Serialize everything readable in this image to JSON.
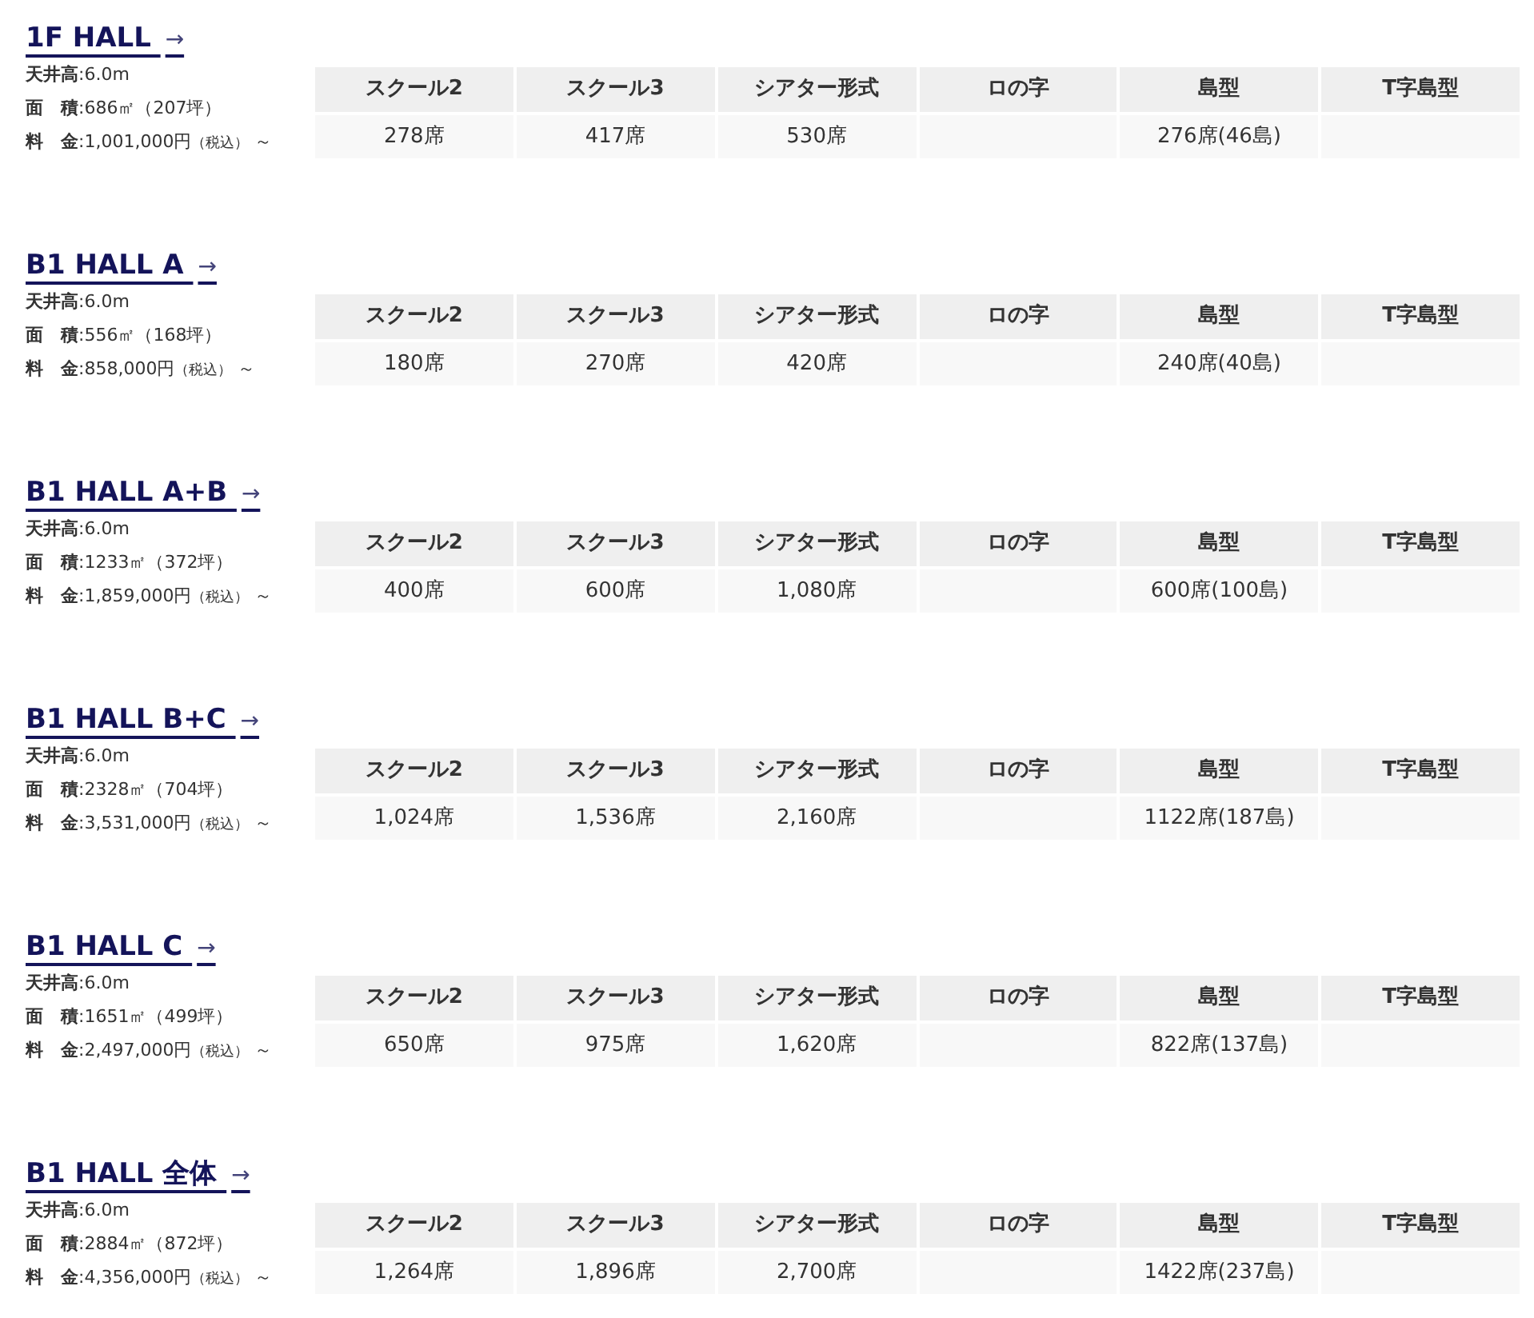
{
  "halls": [
    {
      "title": "1F HALL",
      "arrow": "→",
      "info": [
        {
          "label": "天井高",
          "value": ":6.0m"
        },
        {
          "label": "面　積",
          "value": ":686㎡（207坪）"
        },
        {
          "label": "料　金",
          "value": ":1,001,000円",
          "note": "（税込）",
          "suffix": "～"
        }
      ],
      "columns": [
        "スクール2",
        "スクール3",
        "シアター形式",
        "ロの字",
        "島型",
        "T字島型"
      ],
      "cells": [
        "278席",
        "417席",
        "530席",
        "",
        "276席(46島)",
        ""
      ]
    },
    {
      "title": "B1 HALL A",
      "arrow": "→",
      "info": [
        {
          "label": "天井高",
          "value": ":6.0m"
        },
        {
          "label": "面　積",
          "value": ":556㎡（168坪）"
        },
        {
          "label": "料　金",
          "value": ":858,000円",
          "note": "（税込）",
          "suffix": "～"
        }
      ],
      "columns": [
        "スクール2",
        "スクール3",
        "シアター形式",
        "ロの字",
        "島型",
        "T字島型"
      ],
      "cells": [
        "180席",
        "270席",
        "420席",
        "",
        "240席(40島)",
        ""
      ]
    },
    {
      "title": "B1 HALL A+B",
      "arrow": "→",
      "info": [
        {
          "label": "天井高",
          "value": ":6.0m"
        },
        {
          "label": "面　積",
          "value": ":1233㎡（372坪）"
        },
        {
          "label": "料　金",
          "value": ":1,859,000円",
          "note": "（税込）",
          "suffix": "～"
        }
      ],
      "columns": [
        "スクール2",
        "スクール3",
        "シアター形式",
        "ロの字",
        "島型",
        "T字島型"
      ],
      "cells": [
        "400席",
        "600席",
        "1,080席",
        "",
        "600席(100島)",
        ""
      ]
    },
    {
      "title": "B1 HALL B+C",
      "arrow": "→",
      "info": [
        {
          "label": "天井高",
          "value": ":6.0m"
        },
        {
          "label": "面　積",
          "value": ":2328㎡（704坪）"
        },
        {
          "label": "料　金",
          "value": ":3,531,000円",
          "note": "（税込）",
          "suffix": "～"
        }
      ],
      "columns": [
        "スクール2",
        "スクール3",
        "シアター形式",
        "ロの字",
        "島型",
        "T字島型"
      ],
      "cells": [
        "1,024席",
        "1,536席",
        "2,160席",
        "",
        "1122席(187島)",
        ""
      ]
    },
    {
      "title": "B1 HALL C",
      "arrow": "→",
      "info": [
        {
          "label": "天井高",
          "value": ":6.0m"
        },
        {
          "label": "面　積",
          "value": ":1651㎡（499坪）"
        },
        {
          "label": "料　金",
          "value": ":2,497,000円",
          "note": "（税込）",
          "suffix": "～"
        }
      ],
      "columns": [
        "スクール2",
        "スクール3",
        "シアター形式",
        "ロの字",
        "島型",
        "T字島型"
      ],
      "cells": [
        "650席",
        "975席",
        "1,620席",
        "",
        "822席(137島)",
        ""
      ]
    },
    {
      "title": "B1 HALL 全体",
      "arrow": "→",
      "info": [
        {
          "label": "天井高",
          "value": ":6.0m"
        },
        {
          "label": "面　積",
          "value": ":2884㎡（872坪）"
        },
        {
          "label": "料　金",
          "value": ":4,356,000円",
          "note": "（税込）",
          "suffix": "～"
        }
      ],
      "columns": [
        "スクール2",
        "スクール3",
        "シアター形式",
        "ロの字",
        "島型",
        "T字島型"
      ],
      "cells": [
        "1,264席",
        "1,896席",
        "2,700席",
        "",
        "1422席(237島)",
        ""
      ]
    }
  ]
}
